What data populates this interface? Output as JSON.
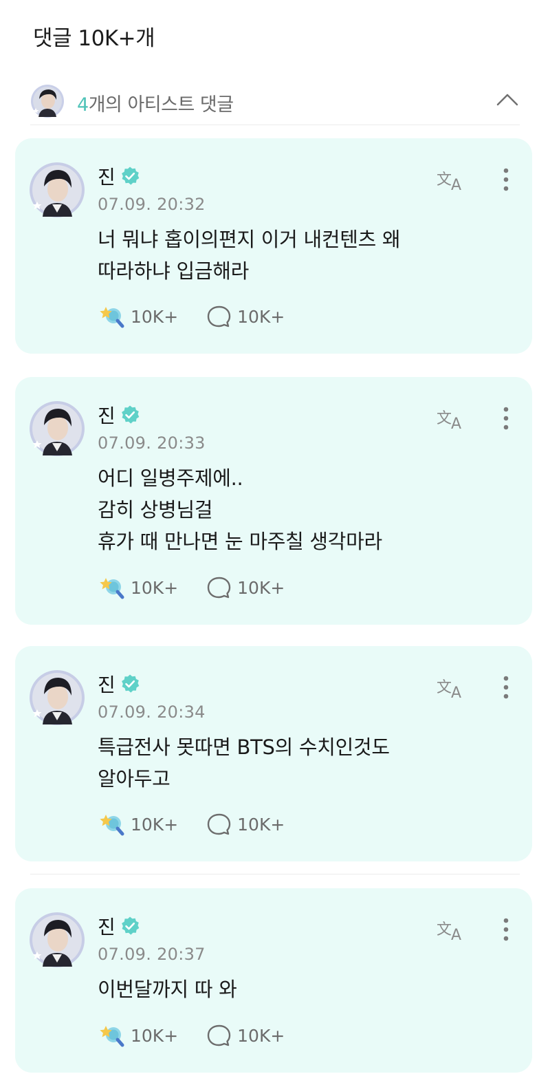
{
  "header": {
    "title": "댓글 10K+개"
  },
  "artist_bar": {
    "count": "4",
    "label_suffix": "개의 아티스트 댓글"
  },
  "colors": {
    "accent": "#4fc3b8",
    "card_bg": "#e9fbf8",
    "verified": "#5fd1c8"
  },
  "comments": [
    {
      "author": "진",
      "time": "07.09. 20:32",
      "lines": [
        "너 뭐냐 홉이의편지 이거 내컨텐츠 왜",
        "따라하냐 입금해라"
      ],
      "likes": "10K+",
      "replies": "10K+"
    },
    {
      "author": "진",
      "time": "07.09. 20:33",
      "lines": [
        "어디 일병주제에..",
        "감히 상병님걸",
        "휴가 때 만나면 눈 마주칠 생각마라"
      ],
      "likes": "10K+",
      "replies": "10K+"
    },
    {
      "author": "진",
      "time": "07.09. 20:34",
      "lines": [
        "특급전사 못따면 BTS의 수치인것도",
        "알아두고"
      ],
      "likes": "10K+",
      "replies": "10K+"
    },
    {
      "author": "진",
      "time": "07.09. 20:37",
      "lines": [
        "이번달까지 따 와"
      ],
      "likes": "10K+",
      "replies": "10K+"
    }
  ]
}
